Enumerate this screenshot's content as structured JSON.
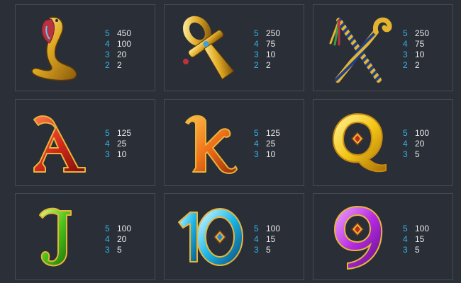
{
  "paytable": [
    {
      "symbol": "cobra-icon",
      "payouts": [
        {
          "n": "5",
          "v": "450"
        },
        {
          "n": "4",
          "v": "100"
        },
        {
          "n": "3",
          "v": "20"
        },
        {
          "n": "2",
          "v": "2"
        }
      ]
    },
    {
      "symbol": "ankh-icon",
      "payouts": [
        {
          "n": "5",
          "v": "250"
        },
        {
          "n": "4",
          "v": "75"
        },
        {
          "n": "3",
          "v": "10"
        },
        {
          "n": "2",
          "v": "2"
        }
      ]
    },
    {
      "symbol": "crook-flail-icon",
      "payouts": [
        {
          "n": "5",
          "v": "250"
        },
        {
          "n": "4",
          "v": "75"
        },
        {
          "n": "3",
          "v": "10"
        },
        {
          "n": "2",
          "v": "2"
        }
      ]
    },
    {
      "symbol": "letter-a-icon",
      "payouts": [
        {
          "n": "5",
          "v": "125"
        },
        {
          "n": "4",
          "v": "25"
        },
        {
          "n": "3",
          "v": "10"
        }
      ]
    },
    {
      "symbol": "letter-k-icon",
      "payouts": [
        {
          "n": "5",
          "v": "125"
        },
        {
          "n": "4",
          "v": "25"
        },
        {
          "n": "3",
          "v": "10"
        }
      ]
    },
    {
      "symbol": "letter-q-icon",
      "payouts": [
        {
          "n": "5",
          "v": "100"
        },
        {
          "n": "4",
          "v": "20"
        },
        {
          "n": "3",
          "v": "5"
        }
      ]
    },
    {
      "symbol": "letter-j-icon",
      "payouts": [
        {
          "n": "5",
          "v": "100"
        },
        {
          "n": "4",
          "v": "20"
        },
        {
          "n": "3",
          "v": "5"
        }
      ]
    },
    {
      "symbol": "number-10-icon",
      "payouts": [
        {
          "n": "5",
          "v": "100"
        },
        {
          "n": "4",
          "v": "15"
        },
        {
          "n": "3",
          "v": "5"
        }
      ]
    },
    {
      "symbol": "number-9-icon",
      "payouts": [
        {
          "n": "5",
          "v": "100"
        },
        {
          "n": "4",
          "v": "15"
        },
        {
          "n": "3",
          "v": "5"
        }
      ]
    }
  ]
}
